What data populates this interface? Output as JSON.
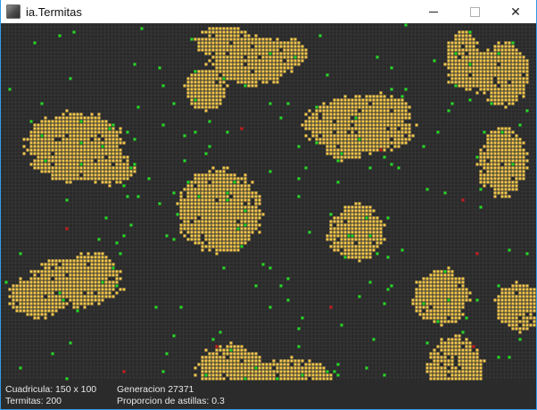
{
  "window": {
    "title": "ia.Termitas",
    "controls": {
      "minimize": "minimize",
      "maximize": "maximize",
      "close": "close"
    }
  },
  "colors": {
    "background": "#2a2a2a",
    "grid_line": "#3c3c3c",
    "wood_chip": "#f5c84a",
    "termite_empty": "#22dd22",
    "termite_carrying": "#d01818",
    "status_text": "#e8e8e8"
  },
  "status": {
    "grid_label": "Cuadricula: 150 x 100",
    "termites_label": "Termitas: 200",
    "generation_label": "Generacion 27371",
    "proportion_label": "Proporcion de astillas: 0.3"
  }
}
